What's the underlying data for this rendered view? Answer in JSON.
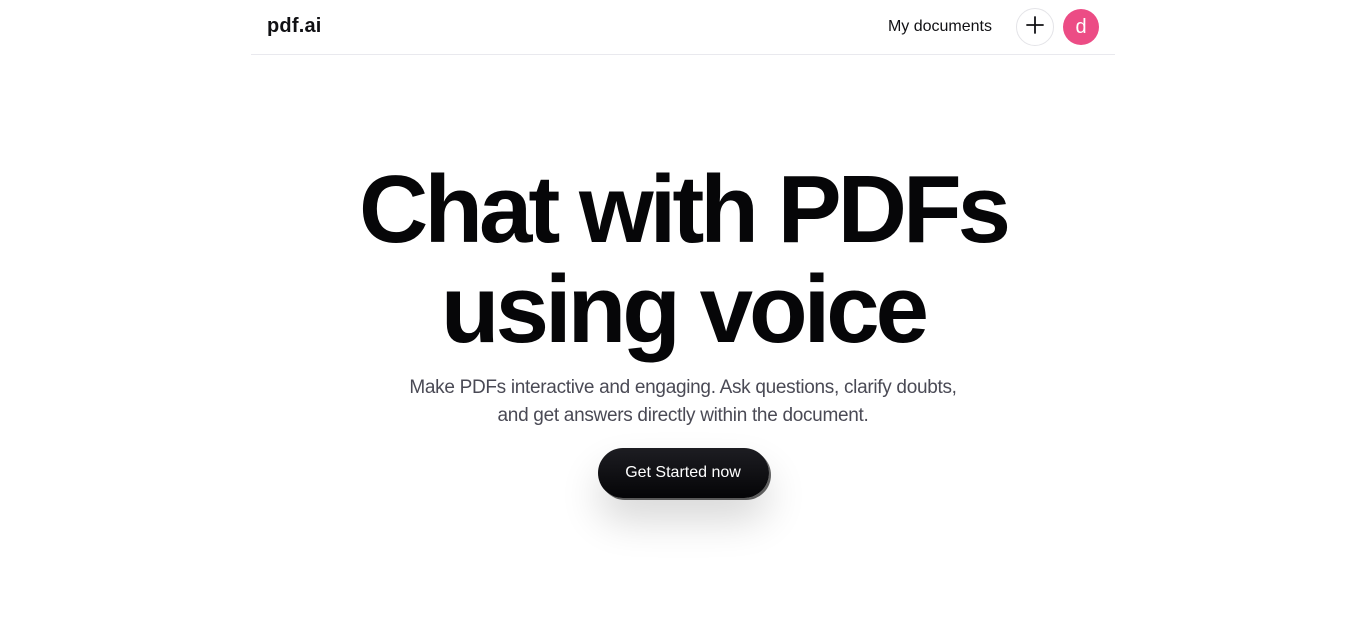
{
  "header": {
    "logo": "pdf.ai",
    "nav_link": "My documents",
    "new_button_icon": "plus-icon",
    "avatar_initial": "d",
    "avatar_color": "#ec4c85"
  },
  "hero": {
    "headline_line1": "Chat with PDFs",
    "headline_line2": "using voice",
    "subtext": "Make PDFs interactive and engaging. Ask questions, clarify doubts, and get answers directly within the document.",
    "cta_label": "Get Started now"
  }
}
